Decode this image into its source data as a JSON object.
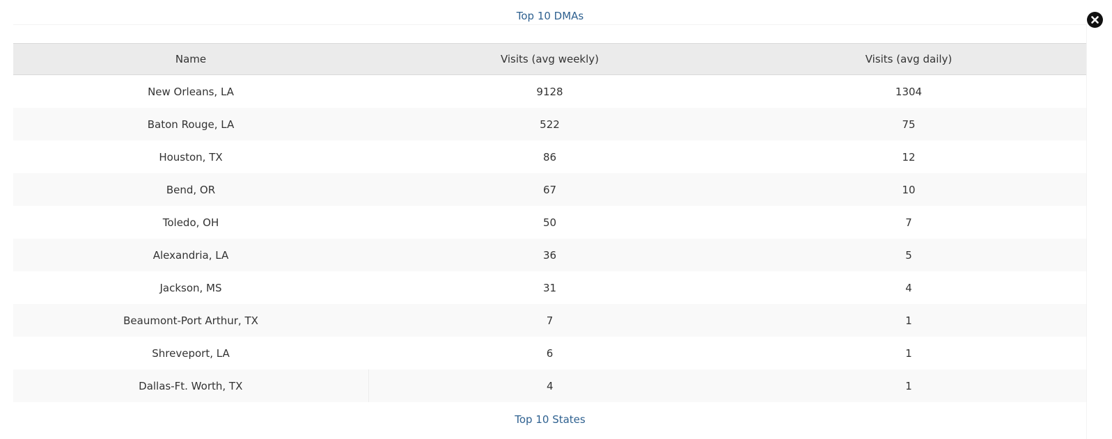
{
  "titles": {
    "top": "Top 10 DMAs",
    "bottom": "Top 10 States"
  },
  "close_icon": "close-circle-icon",
  "table": {
    "headers": [
      "Name",
      "Visits (avg weekly)",
      "Visits (avg daily)"
    ],
    "rows": [
      [
        "New Orleans, LA",
        "9128",
        "1304"
      ],
      [
        "Baton Rouge, LA",
        "522",
        "75"
      ],
      [
        "Houston, TX",
        "86",
        "12"
      ],
      [
        "Bend, OR",
        "67",
        "10"
      ],
      [
        "Toledo, OH",
        "50",
        "7"
      ],
      [
        "Alexandria, LA",
        "36",
        "5"
      ],
      [
        "Jackson, MS",
        "31",
        "4"
      ],
      [
        "Beaumont-Port Arthur, TX",
        "7",
        "1"
      ],
      [
        "Shreveport, LA",
        "6",
        "1"
      ],
      [
        "Dallas-Ft. Worth, TX",
        "4",
        "1"
      ]
    ]
  },
  "colors": {
    "link": "#2f6190",
    "header_bg": "#ebebeb",
    "stripe_bg": "#f9f9f9"
  }
}
